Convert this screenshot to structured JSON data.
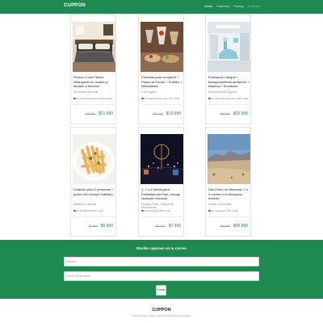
{
  "navbar": {
    "brand": "CUPPON",
    "links": [
      "Home",
      "Features",
      "Pricing",
      "Disabled"
    ]
  },
  "cards": [
    {
      "image": "bedroom",
      "title": "Plumón Coral Fleece estampado en modelo y tamaño a elección",
      "seller": "Plumones Nacional",
      "location": "Av. Vicuña Mackenna 2932, Chile",
      "old_price": "$44.980",
      "new_price": "$21.990"
    },
    {
      "image": "cocktails",
      "title": "Entradas para compartir + Platos de Fondo + Postres + Bebestibles",
      "seller": "Il for Vegan",
      "location": "Av. Italia Providencia 1771, Chile",
      "old_price": "$26.190",
      "new_price": "$13.990"
    },
    {
      "image": "clinic",
      "title": "Evaluación integral + Blanqueamiento dental led + limpieza + fluoración",
      "seller": "Clínica Dental Cuppon",
      "location": "Av. Nueva Providencia 1363, Chile",
      "old_price": "$99.990",
      "new_price": "$20.990"
    },
    {
      "image": "pasta",
      "title": "Colación para 2 personas + postre (No incluye bebidas)",
      "seller": "Cantina La Nonna",
      "location": "Av. Bellavista 0101, Chile",
      "old_price": "$7.980",
      "new_price": "$5.990"
    },
    {
      "image": "park",
      "title": "1, 2 o 4 tickets para Fantasilandia Park, escoge cualquier sucursal",
      "seller": "Fantasy Park · Parque de Diversiones",
      "location": "Av. Beaucheff 938, Chile",
      "old_price": "$11.900",
      "new_price": "$7.490"
    },
    {
      "image": "desert",
      "title": "San Pedro de Atacama: 1 o 2 noches con desayuno incluido",
      "seller": "Hostal Las Bordas",
      "location": "Av. Caracoles 150, Chile",
      "old_price": "$69.990",
      "new_price": "$49.990"
    }
  ],
  "subscribe": {
    "title": "Recibe cupones en tu correo",
    "name_placeholder": "Nombre",
    "email_placeholder": "Correo Electrónico",
    "button": "Enviar"
  },
  "footer": {
    "brand": "CUPPON",
    "copyright": "© 2018 Cuppon Latam. Todos los derechos reservados."
  },
  "colors": {
    "primary": "#1e8a52",
    "price": "#1e8a52"
  }
}
